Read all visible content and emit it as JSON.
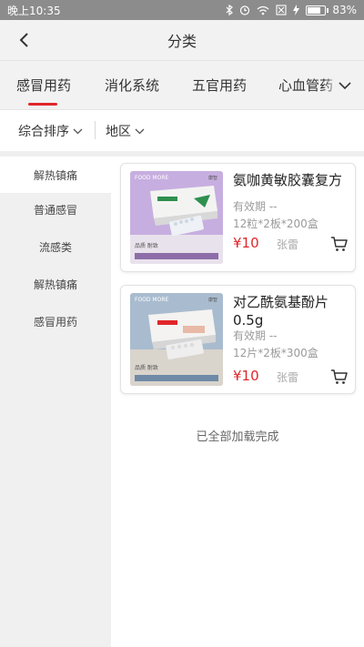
{
  "status_bar": {
    "time": "晚上10:35",
    "battery_text": "83%",
    "battery_level": 0.83
  },
  "header": {
    "title": "分类"
  },
  "tabs": [
    {
      "label": "感冒用药",
      "active": true
    },
    {
      "label": "消化系统",
      "active": false
    },
    {
      "label": "五官用药",
      "active": false
    },
    {
      "label": "心血管药",
      "active": false
    }
  ],
  "filters": {
    "sort_label": "综合排序",
    "region_label": "地区"
  },
  "sidebar": {
    "items": [
      {
        "label": "解热镇痛",
        "active": true
      },
      {
        "label": "普通感冒",
        "active": false
      },
      {
        "label": "流感类",
        "active": false
      },
      {
        "label": "解热镇痛",
        "active": false
      },
      {
        "label": "感冒用药",
        "active": false
      }
    ]
  },
  "products": [
    {
      "name": "氨咖黄敏胶囊复方",
      "expiry": "有效期 --",
      "spec": "12粒*2板*200盒",
      "price": "¥10",
      "seller": "张雷",
      "package_brand": "FOOD MORE",
      "package_logo": "康智",
      "package_text": "品质 耐致",
      "accent_color": "#2f8f4e"
    },
    {
      "name": "对乙酰氨基酚片0.5g",
      "expiry": "有效期 --",
      "spec": "12片*2板*300盒",
      "price": "¥10",
      "seller": "张雷",
      "package_brand": "FOOD MORE",
      "package_logo": "康智",
      "package_text": "品质 耐致",
      "accent_color": "#e0262a"
    }
  ],
  "list_end_text": "已全部加载完成",
  "colors": {
    "accent_red": "#e0262a",
    "header_bg": "#f2f2f2",
    "sidebar_bg": "#f0f0f0"
  }
}
